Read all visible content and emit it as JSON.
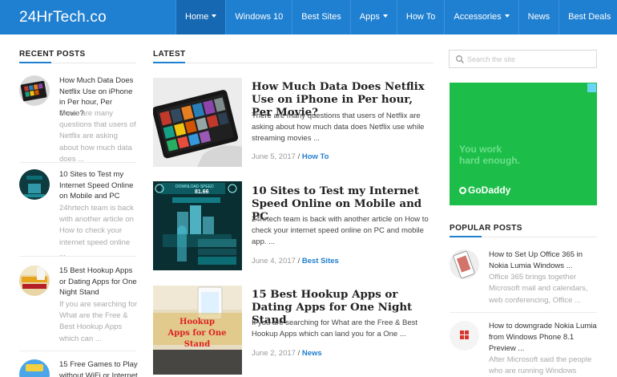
{
  "site": {
    "logo": "24HrTech.co"
  },
  "nav": [
    {
      "label": "Home",
      "dropdown": true,
      "active": true
    },
    {
      "label": "Windows 10",
      "dropdown": false,
      "active": false
    },
    {
      "label": "Best Sites",
      "dropdown": false,
      "active": false
    },
    {
      "label": "Apps",
      "dropdown": true,
      "active": false
    },
    {
      "label": "How To",
      "dropdown": false,
      "active": false
    },
    {
      "label": "Accessories",
      "dropdown": true,
      "active": false
    },
    {
      "label": "News",
      "dropdown": false,
      "active": false
    },
    {
      "label": "Best Deals",
      "dropdown": false,
      "active": false
    }
  ],
  "recent": {
    "heading": "RECENT POSTS",
    "items": [
      {
        "title": "How Much Data Does Netflix Use on iPhone in Per hour, Per Movie?",
        "excerpt": "There are many questions that users of Netflix are asking about how much data does ..."
      },
      {
        "title": "10 Sites to Test my Internet Speed Online on Mobile and PC",
        "excerpt": "24hrtech team is back with another article on How to check your internet speed online ..."
      },
      {
        "title": "15 Best Hookup Apps or Dating Apps for One Night Stand",
        "excerpt": "If you are searching for What are the Free & Best Hookup Apps which can ..."
      },
      {
        "title": "15 Free Games to Play without WiFi or Internet",
        "excerpt": ""
      }
    ]
  },
  "latest": {
    "heading": "LATEST",
    "posts": [
      {
        "title": "How Much Data Does Netflix Use on iPhone in Per hour, Per Movie?",
        "excerpt": "There are many questions that users of Netflix are asking about how much data does Netflix use while streaming movies ...",
        "date": "June 5, 2017",
        "sep": "/",
        "category": "How To"
      },
      {
        "title": "10 Sites to Test my Internet Speed Online on Mobile and PC",
        "excerpt": "24hrtech team is back with another article on How to check your internet speed online on PC and mobile app. ...",
        "date": "June 4, 2017",
        "sep": "/",
        "category": "Best Sites"
      },
      {
        "title": "15 Best Hookup Apps or Dating Apps for One Night Stand",
        "excerpt": "If you are searching for What are the Free & Best Hookup Apps which can land you for a One ...",
        "date": "June 2, 2017",
        "sep": "/",
        "category": "News"
      }
    ]
  },
  "thumbs": {
    "speed_value": "81.66",
    "speed_label": "DOWNLOAD SPEED",
    "hookup_text": "Hookup\nApps for One\nStand"
  },
  "search": {
    "placeholder": "Search the site"
  },
  "ad": {
    "tagline": "You work\nhard enough.",
    "brand": "GoDaddy"
  },
  "popular": {
    "heading": "POPULAR POSTS",
    "items": [
      {
        "title": "How to Set Up Office 365 in Nokia Lumia Windows ...",
        "excerpt": "Office 365 brings together Microsoft mail and calendars, web conferencing, Office ..."
      },
      {
        "title": "How to downgrade Nokia Lumia from Windows Phone 8.1 Preview ...",
        "excerpt": "After Microsoft said the people who are running Windows"
      }
    ]
  },
  "colors": {
    "primary": "#1f7fd0",
    "nav_active": "#1668b2",
    "ad_bg": "#1dbd49"
  }
}
